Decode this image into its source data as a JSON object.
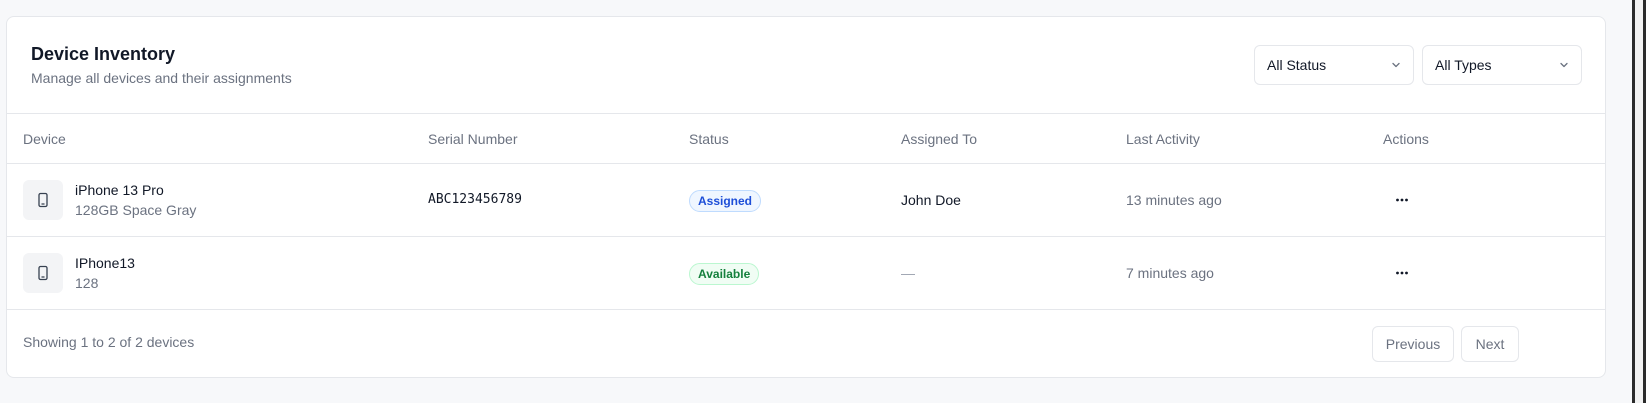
{
  "header": {
    "title": "Device Inventory",
    "subtitle": "Manage all devices and their assignments",
    "status_filter": "All Status",
    "type_filter": "All Types"
  },
  "table": {
    "columns": [
      "Device",
      "Serial Number",
      "Status",
      "Assigned To",
      "Last Activity",
      "Actions"
    ],
    "rows": [
      {
        "name": "iPhone 13 Pro",
        "detail": "128GB Space Gray",
        "serial": "ABC123456789",
        "status": "Assigned",
        "assigned_to": "John Doe",
        "last_activity": "13 minutes ago"
      },
      {
        "name": "IPhone13",
        "detail": "128",
        "serial": "",
        "status": "Available",
        "assigned_to": "—",
        "last_activity": "7 minutes ago"
      }
    ]
  },
  "footer": {
    "showing": "Showing 1 to 2 of 2 devices",
    "previous": "Previous",
    "next": "Next"
  },
  "icons": {
    "device": "phone-icon",
    "filter_chevron": "chevron-down-icon",
    "actions": "more-horizontal-icon"
  },
  "colors": {
    "assigned_badge": "#1d4ed8",
    "available_badge": "#15803d"
  }
}
